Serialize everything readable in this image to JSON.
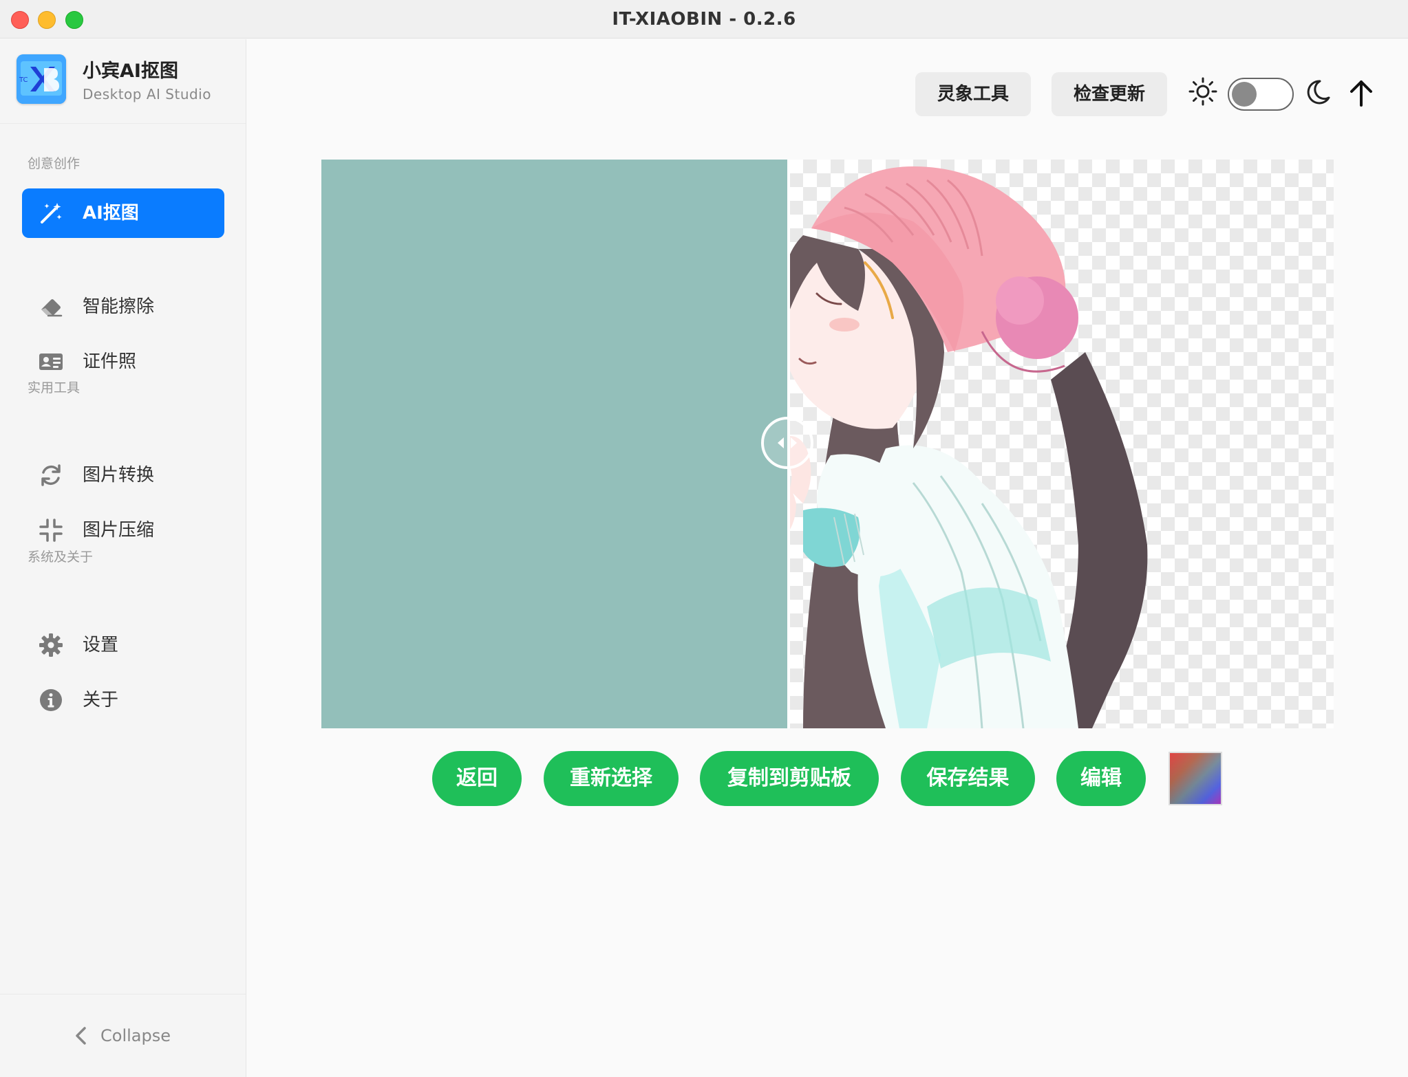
{
  "window": {
    "title": "IT-XIAOBIN - 0.2.6"
  },
  "brand": {
    "name": "小宾AI抠图",
    "subtitle": "Desktop AI Studio"
  },
  "sidebar": {
    "sections": [
      {
        "title": "创意创作",
        "items": [
          {
            "label": "AI抠图",
            "icon": "magic-wand-icon",
            "active": true
          },
          {
            "label": "智能擦除",
            "icon": "eraser-icon",
            "active": false
          },
          {
            "label": "证件照",
            "icon": "id-card-icon",
            "active": false
          }
        ]
      },
      {
        "title": "实用工具",
        "items": [
          {
            "label": "图片转换",
            "icon": "refresh-icon",
            "active": false
          },
          {
            "label": "图片压缩",
            "icon": "compress-icon",
            "active": false
          }
        ]
      },
      {
        "title": "系统及关于",
        "items": [
          {
            "label": "设置",
            "icon": "gear-icon",
            "active": false
          },
          {
            "label": "关于",
            "icon": "info-icon",
            "active": false
          }
        ]
      }
    ],
    "collapse_label": "Collapse"
  },
  "header": {
    "lingxiang_label": "灵象工具",
    "check_update_label": "检查更新",
    "theme_toggle_on": false
  },
  "compare": {
    "background_color": "#93bfba",
    "split_position": 0.46
  },
  "actions": {
    "back_label": "返回",
    "reselect_label": "重新选择",
    "copy_label": "复制到剪贴板",
    "save_label": "保存结果",
    "edit_label": "编辑"
  },
  "colors": {
    "accent": "#0a7cff",
    "action_green": "#1fbf59"
  }
}
